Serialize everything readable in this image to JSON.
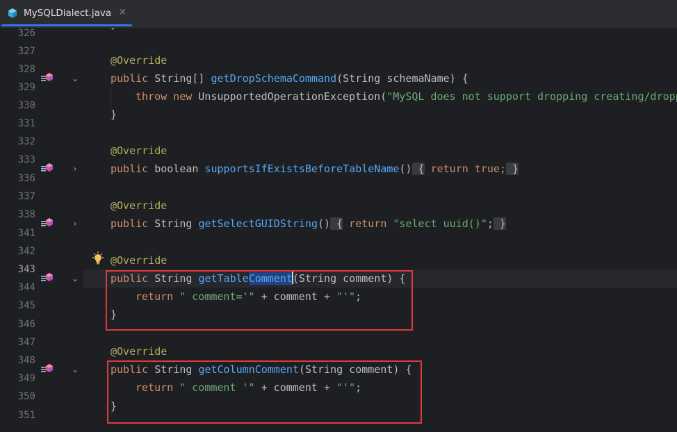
{
  "tab": {
    "filename": "MySQLDialect.java",
    "close_symbol": "×"
  },
  "line_numbers": [
    "326",
    "327",
    "328",
    "329",
    "330",
    "331",
    "332",
    "333",
    "336",
    "337",
    "338",
    "341",
    "342",
    "343",
    "344",
    "345",
    "346",
    "347",
    "348",
    "349",
    "350",
    "351"
  ],
  "code": {
    "l327": {
      "ann": "@Override"
    },
    "l328": {
      "kw": "public",
      "type": " String[] ",
      "fn": "getDropSchemaCommand",
      "params": "(String schemaName) ",
      "brace": "{"
    },
    "l329": {
      "kw1": "throw",
      "kw2": " new",
      "cls": " UnsupportedOperationException(",
      "str": "\"MySQL does not support dropping creating/dropping schemas\""
    },
    "l330": {
      "brace": "}"
    },
    "l332": {
      "ann": "@Override"
    },
    "l333": {
      "kw": "public",
      "type": " boolean ",
      "fn": "supportsIfExistsBeforeTableName",
      "params": "()",
      "fold_open": " {",
      "ret_kw": " return",
      "ret_val": " true;",
      "fold_close": " }"
    },
    "l337": {
      "ann": "@Override"
    },
    "l338": {
      "kw": "public",
      "type": " String ",
      "fn": "getSelectGUIDString",
      "params": "()",
      "fold_open": " {",
      "ret_kw": " return",
      "ret_str": " \"select uuid()\"",
      "semi": ";",
      "fold_close": " }"
    },
    "l342": {
      "ann": "@Override"
    },
    "l343": {
      "kw": "public",
      "type": " String ",
      "fn_a": "getTable",
      "fn_b": "Comment",
      "params": "(String comment) ",
      "brace": "{"
    },
    "l344": {
      "kw": "return",
      "str1": " \" comment='\"",
      "mid": " + comment + ",
      "str2": "\"'\"",
      "semi": ";"
    },
    "l345": {
      "brace": "}"
    },
    "l347": {
      "ann": "@Override"
    },
    "l348": {
      "kw": "public",
      "type": " String ",
      "fn": "getColumnComment",
      "params": "(String comment) ",
      "brace": "{"
    },
    "l349": {
      "kw": "return",
      "str1": " \" comment '\"",
      "mid": " + comment + ",
      "str2": "\"'\"",
      "semi": ";"
    },
    "l350": {
      "brace": "}"
    }
  },
  "colors": {
    "keyword": "#cf8e6d",
    "annotation": "#b3ae60",
    "method": "#56a8f5",
    "string": "#6aab73",
    "text": "#bcbec4",
    "highlight_box": "#e03a3a",
    "tab_accent": "#3574f0"
  },
  "icons": {
    "file": "java-class-icon",
    "override": "override-method-icon",
    "intention": "lightbulb-icon"
  }
}
